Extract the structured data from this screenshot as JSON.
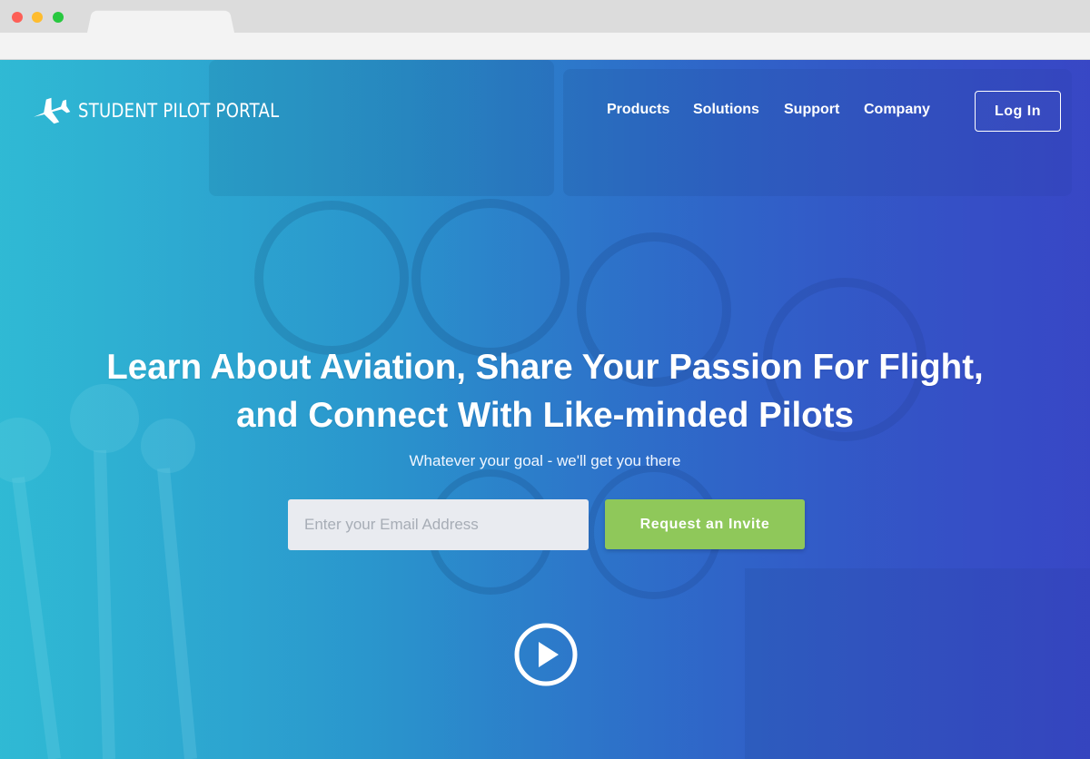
{
  "browser": {
    "tab_label": ""
  },
  "header": {
    "brand": "STUDENT PILOT PORTAL",
    "brand_icon": "airplane-icon",
    "nav": [
      "Products",
      "Solutions",
      "Support",
      "Company"
    ],
    "login_label": "Log In"
  },
  "hero": {
    "headline_line1": "Learn About Aviation, Share Your Passion For Flight,",
    "headline_line2": "and Connect With Like-minded Pilots",
    "subtitle": "Whatever your goal - we'll get you there",
    "email_placeholder": "Enter your Email Address",
    "cta_label": "Request an Invite",
    "play_icon": "play-icon"
  },
  "colors": {
    "cta_green": "#8fc85a",
    "gradient_start": "#2fb7d3",
    "gradient_end": "#3848c2"
  }
}
